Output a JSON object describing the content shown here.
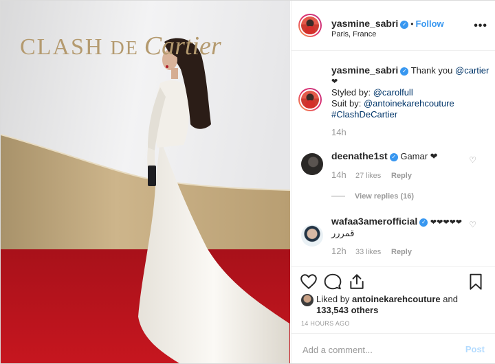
{
  "photo": {
    "backdrop_text_1": "CLASH",
    "backdrop_text_2": "DE",
    "backdrop_text_3": "Cartier"
  },
  "header": {
    "username": "yasmine_sabri",
    "separator": "•",
    "follow_label": "Follow",
    "location": "Paris, France",
    "more_label": "•••"
  },
  "caption": {
    "username": "yasmine_sabri",
    "text_1": "Thank you",
    "mention_1": "@cartier",
    "heart": "❤",
    "styled_label": "Styled by:",
    "mention_2": "@carolfull",
    "suit_label": "Suit by:",
    "mention_3": "@antoinekarehcouture",
    "hashtag": "#ClashDeCartier",
    "time": "14h"
  },
  "comments": [
    {
      "username": "deenathe1st",
      "text": "Gamar ❤",
      "time": "14h",
      "likes": "27 likes",
      "reply": "Reply",
      "view_replies": "View replies (16)"
    },
    {
      "username": "wafaa3amerofficial",
      "text": "❤❤❤❤❤",
      "text_2": "قمررر",
      "time": "12h",
      "likes": "33 likes",
      "reply": "Reply"
    }
  ],
  "likes": {
    "prefix": "Liked by",
    "user": "antoinekarehcouture",
    "and": "and",
    "count": "133,543 others"
  },
  "post_age": "14 HOURS AGO",
  "add_comment": {
    "placeholder": "Add a comment...",
    "post_label": "Post"
  },
  "colors": {
    "link_blue": "#3897f0",
    "mention_blue": "#003569",
    "muted": "#999999",
    "carpet_red": "#b3121b",
    "gold": "#b49a6f"
  },
  "icons": [
    "verified-icon",
    "more-icon",
    "heart-icon",
    "comment-icon",
    "share-icon",
    "bookmark-icon"
  ]
}
